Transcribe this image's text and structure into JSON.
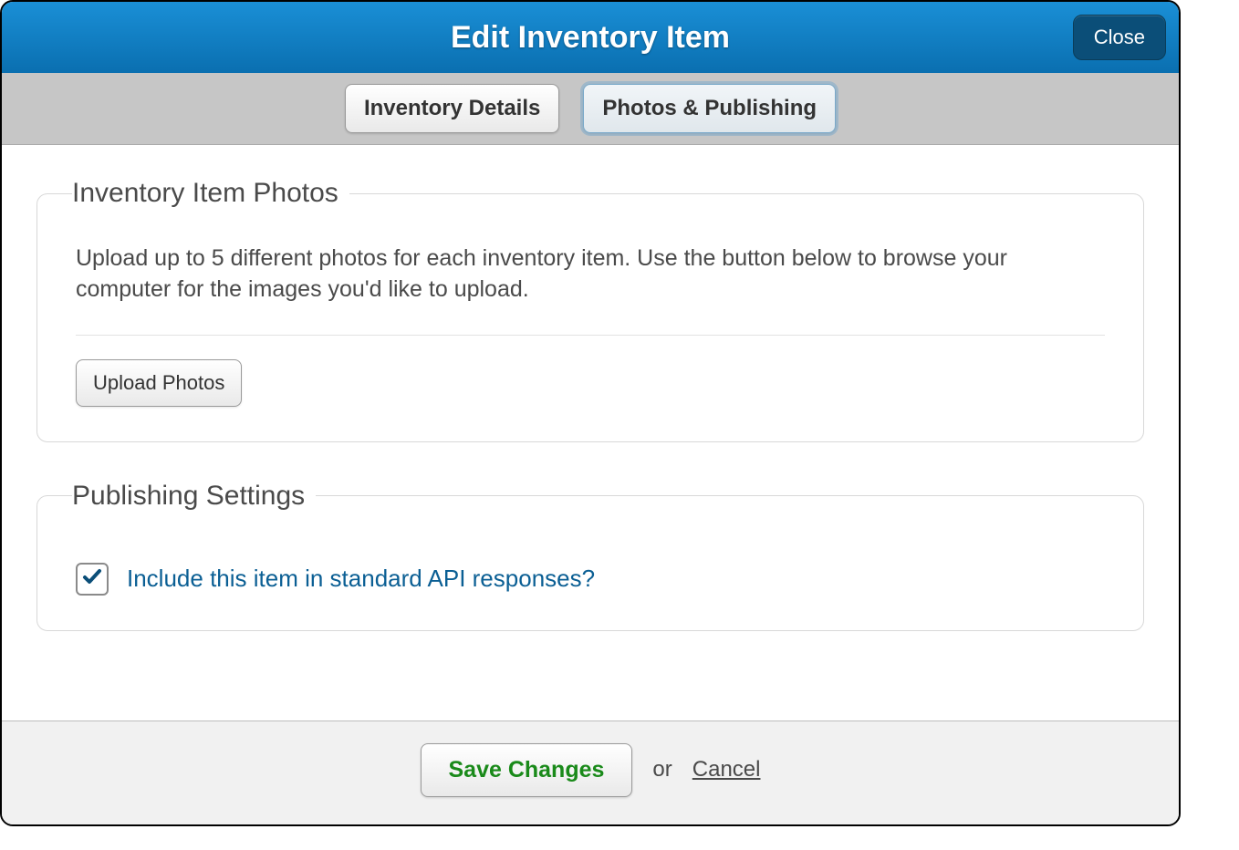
{
  "header": {
    "title": "Edit Inventory Item",
    "close_label": "Close"
  },
  "tabs": {
    "inventory_details": "Inventory Details",
    "photos_publishing": "Photos & Publishing"
  },
  "photos_panel": {
    "legend": "Inventory Item Photos",
    "description": "Upload up to 5 different photos for each inventory item. Use the button below to browse your computer for the images you'd like to upload.",
    "upload_label": "Upload Photos"
  },
  "publishing_panel": {
    "legend": "Publishing Settings",
    "checkbox_label": "Include this item in standard API responses?",
    "checkbox_checked": true
  },
  "footer": {
    "save_label": "Save Changes",
    "or_text": "or",
    "cancel_label": "Cancel"
  }
}
